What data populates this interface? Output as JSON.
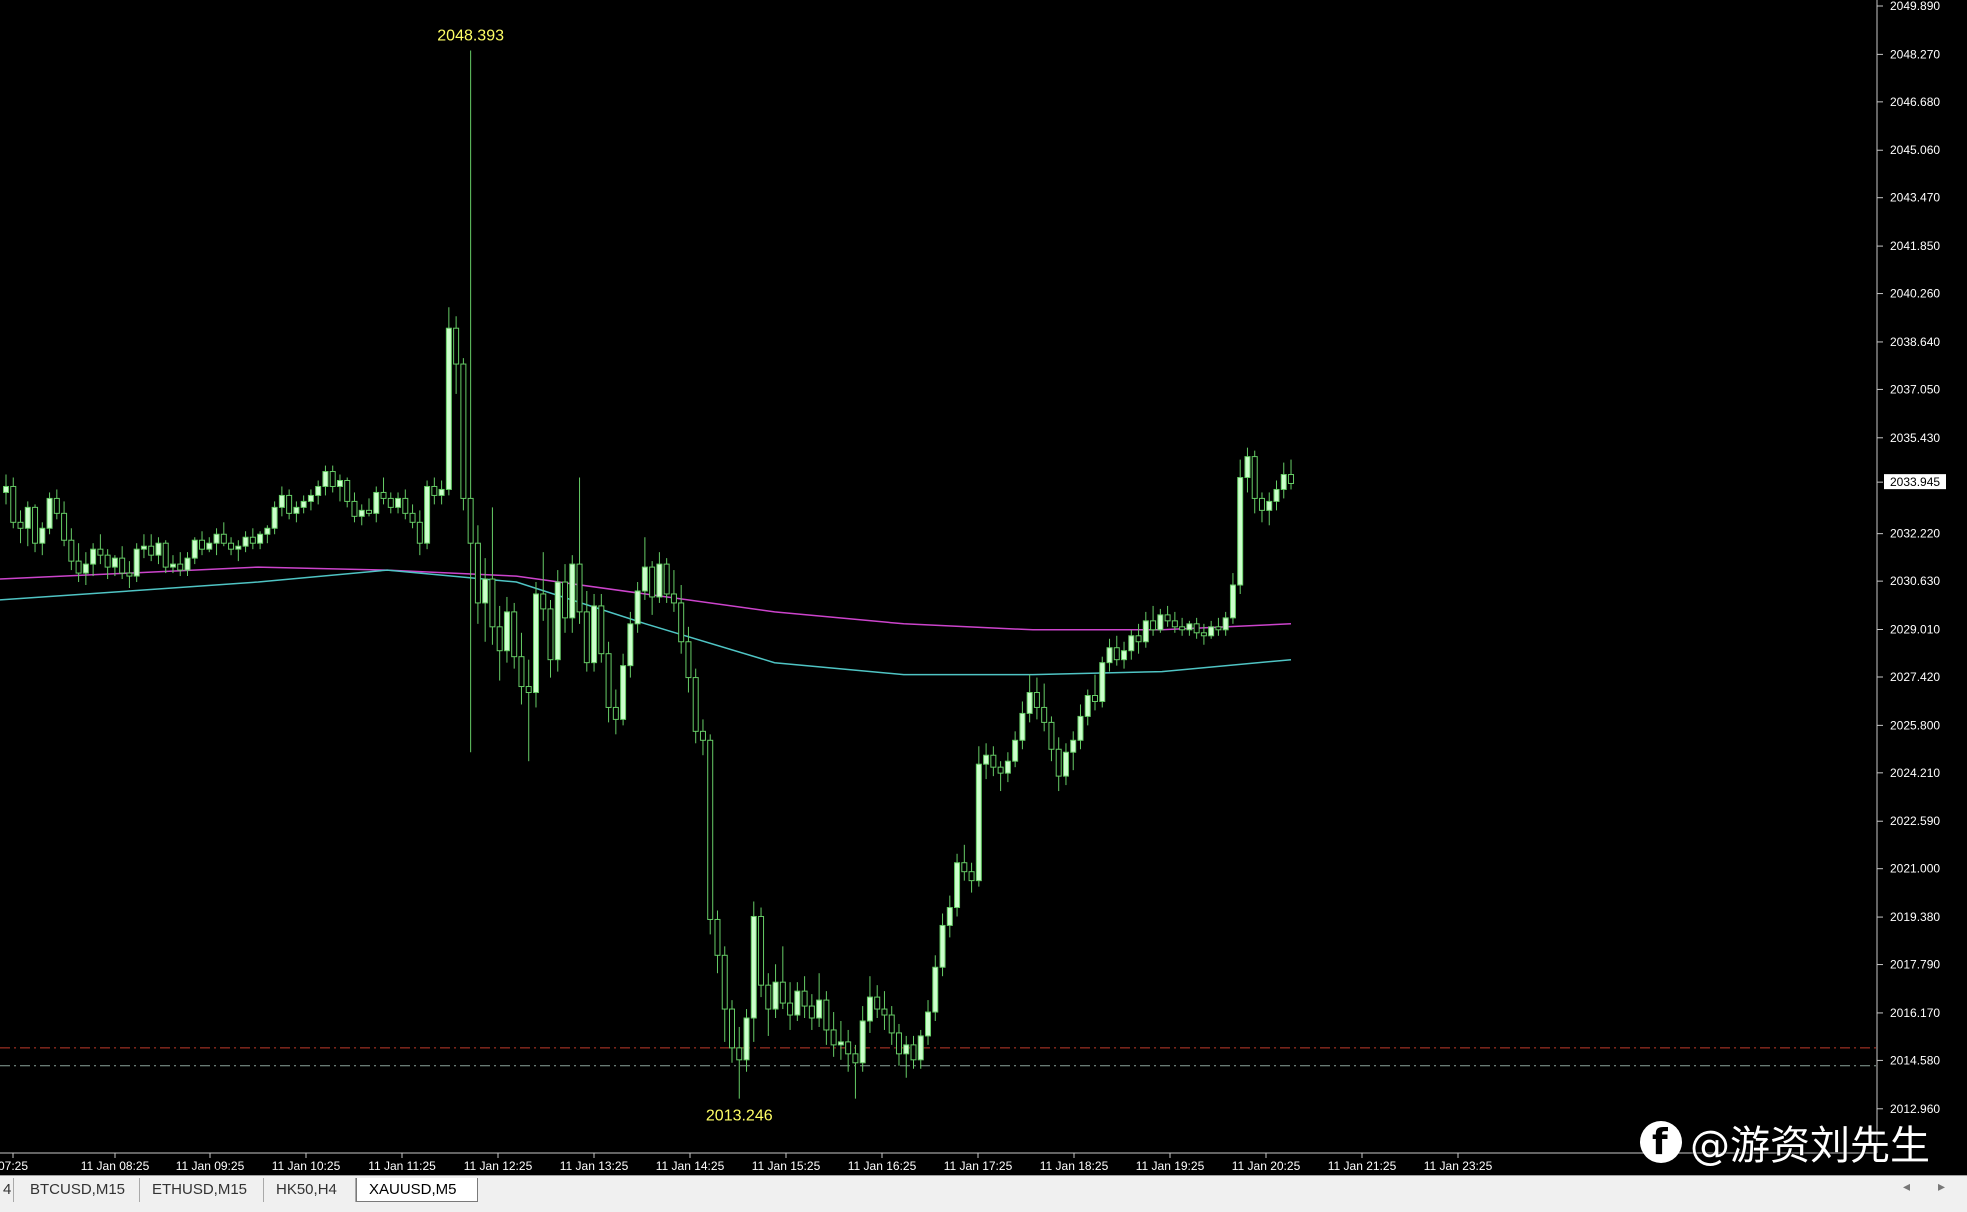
{
  "chart_data": {
    "type": "candlestick",
    "symbol": "XAUUSD,M5",
    "ylim": [
      2012.35,
      2049.89
    ],
    "y_ticks": [
      "2049.890",
      "2048.270",
      "2046.680",
      "2045.060",
      "2043.470",
      "2041.850",
      "2040.260",
      "2038.640",
      "2037.050",
      "2035.430",
      "2033.945",
      "2032.220",
      "2030.630",
      "2029.010",
      "2027.420",
      "2025.800",
      "2024.210",
      "2022.590",
      "2021.000",
      "2019.380",
      "2017.790",
      "2016.170",
      "2014.580",
      "2012.960"
    ],
    "current_price": "2033.945",
    "x_ticks": [
      "07:25",
      "11 Jan 08:25",
      "11 Jan 09:25",
      "11 Jan 10:25",
      "11 Jan 11:25",
      "11 Jan 12:25",
      "11 Jan 13:25",
      "11 Jan 14:25",
      "11 Jan 15:25",
      "11 Jan 16:25",
      "11 Jan 17:25",
      "11 Jan 18:25",
      "11 Jan 19:25",
      "11 Jan 20:25",
      "11 Jan 21:25",
      "11 Jan 23:25"
    ],
    "annotations": {
      "high": "2048.393",
      "low": "2013.246"
    },
    "horizontal_lines": [
      {
        "value": 2015.0,
        "color": "#c0392b",
        "style": "dash-dot"
      },
      {
        "value": 2014.4,
        "color": "#8aa39a",
        "style": "dash-dot"
      }
    ],
    "moving_averages": [
      {
        "color": "#cc44cc",
        "points": [
          2030.7,
          2030.9,
          2031.1,
          2031.0,
          2030.8,
          2030.2,
          2029.6,
          2029.2,
          2029.0,
          2029.0,
          2029.2
        ]
      },
      {
        "color": "#4fc4c4",
        "points": [
          2030.0,
          2030.3,
          2030.6,
          2031.0,
          2030.6,
          2029.2,
          2027.9,
          2027.5,
          2027.5,
          2027.6,
          2028.0
        ]
      }
    ],
    "candles": [
      [
        2033.6,
        2034.2,
        2033.2,
        2033.8
      ],
      [
        2033.8,
        2034.1,
        2032.4,
        2032.6
      ],
      [
        2032.6,
        2033.0,
        2031.9,
        2032.4
      ],
      [
        2032.4,
        2033.3,
        2031.8,
        2033.1
      ],
      [
        2033.1,
        2033.2,
        2031.6,
        2031.9
      ],
      [
        2031.9,
        2032.6,
        2031.5,
        2032.4
      ],
      [
        2032.4,
        2033.6,
        2032.2,
        2033.4
      ],
      [
        2033.4,
        2033.7,
        2032.7,
        2032.9
      ],
      [
        2032.9,
        2033.3,
        2031.8,
        2032.0
      ],
      [
        2032.0,
        2032.4,
        2031.0,
        2031.3
      ],
      [
        2031.3,
        2031.9,
        2030.6,
        2030.9
      ],
      [
        2030.9,
        2031.6,
        2030.5,
        2031.2
      ],
      [
        2031.2,
        2031.9,
        2030.8,
        2031.7
      ],
      [
        2031.7,
        2032.2,
        2031.2,
        2031.5
      ],
      [
        2031.5,
        2031.7,
        2030.7,
        2031.1
      ],
      [
        2031.1,
        2031.5,
        2030.8,
        2031.4
      ],
      [
        2031.4,
        2031.8,
        2030.7,
        2030.9
      ],
      [
        2030.9,
        2031.3,
        2030.4,
        2030.8
      ],
      [
        2030.8,
        2031.9,
        2030.6,
        2031.7
      ],
      [
        2031.7,
        2032.2,
        2031.4,
        2031.8
      ],
      [
        2031.8,
        2032.2,
        2031.3,
        2031.5
      ],
      [
        2031.5,
        2032.1,
        2031.2,
        2031.9
      ],
      [
        2031.9,
        2032.0,
        2030.9,
        2031.1
      ],
      [
        2031.1,
        2031.5,
        2030.9,
        2031.2
      ],
      [
        2031.2,
        2031.6,
        2030.8,
        2031.0
      ],
      [
        2031.0,
        2031.6,
        2030.8,
        2031.4
      ],
      [
        2031.4,
        2032.1,
        2031.2,
        2032.0
      ],
      [
        2032.0,
        2032.3,
        2031.5,
        2031.7
      ],
      [
        2031.7,
        2032.1,
        2031.6,
        2031.9
      ],
      [
        2031.9,
        2032.4,
        2031.5,
        2032.2
      ],
      [
        2032.2,
        2032.6,
        2031.8,
        2031.9
      ],
      [
        2031.9,
        2032.1,
        2031.5,
        2031.7
      ],
      [
        2031.7,
        2032.0,
        2031.3,
        2031.8
      ],
      [
        2031.8,
        2032.3,
        2031.6,
        2032.1
      ],
      [
        2032.1,
        2032.4,
        2031.7,
        2031.9
      ],
      [
        2031.9,
        2032.3,
        2031.7,
        2032.2
      ],
      [
        2032.2,
        2032.5,
        2031.9,
        2032.4
      ],
      [
        2032.4,
        2033.3,
        2032.2,
        2033.1
      ],
      [
        2033.1,
        2033.8,
        2032.8,
        2033.5
      ],
      [
        2033.5,
        2033.7,
        2032.7,
        2032.9
      ],
      [
        2032.9,
        2033.3,
        2032.6,
        2033.1
      ],
      [
        2033.1,
        2033.5,
        2032.9,
        2033.3
      ],
      [
        2033.3,
        2033.7,
        2033.0,
        2033.5
      ],
      [
        2033.5,
        2034.0,
        2033.2,
        2033.8
      ],
      [
        2033.8,
        2034.5,
        2033.5,
        2034.3
      ],
      [
        2034.3,
        2034.5,
        2033.6,
        2033.8
      ],
      [
        2033.8,
        2034.2,
        2033.3,
        2034.0
      ],
      [
        2034.0,
        2034.1,
        2033.1,
        2033.3
      ],
      [
        2033.3,
        2033.6,
        2032.6,
        2032.8
      ],
      [
        2032.8,
        2033.2,
        2032.5,
        2033.0
      ],
      [
        2033.0,
        2033.4,
        2032.8,
        2032.9
      ],
      [
        2032.9,
        2033.8,
        2032.6,
        2033.6
      ],
      [
        2033.6,
        2034.1,
        2033.2,
        2033.4
      ],
      [
        2033.4,
        2033.6,
        2032.9,
        2033.1
      ],
      [
        2033.1,
        2033.6,
        2032.9,
        2033.4
      ],
      [
        2033.4,
        2033.7,
        2032.7,
        2032.9
      ],
      [
        2032.9,
        2033.2,
        2032.4,
        2032.6
      ],
      [
        2032.6,
        2033.0,
        2031.5,
        2031.9
      ],
      [
        2031.9,
        2034.0,
        2031.7,
        2033.8
      ],
      [
        2033.8,
        2034.1,
        2033.2,
        2033.5
      ],
      [
        2033.5,
        2034.0,
        2033.2,
        2033.7
      ],
      [
        2033.7,
        2039.8,
        2033.5,
        2039.1
      ],
      [
        2039.1,
        2039.5,
        2036.9,
        2037.9
      ],
      [
        2037.9,
        2038.1,
        2033.0,
        2033.4
      ],
      [
        2033.4,
        2048.4,
        2024.9,
        2031.9
      ],
      [
        2031.9,
        2032.5,
        2029.2,
        2029.9
      ],
      [
        2029.9,
        2031.4,
        2028.6,
        2030.7
      ],
      [
        2030.7,
        2033.1,
        2028.5,
        2029.1
      ],
      [
        2029.1,
        2029.8,
        2027.3,
        2028.3
      ],
      [
        2028.3,
        2030.1,
        2027.9,
        2029.6
      ],
      [
        2029.6,
        2029.9,
        2027.7,
        2028.1
      ],
      [
        2028.1,
        2028.9,
        2026.5,
        2027.1
      ],
      [
        2027.1,
        2028.0,
        2024.6,
        2026.9
      ],
      [
        2026.9,
        2030.6,
        2026.4,
        2030.2
      ],
      [
        2030.2,
        2031.6,
        2029.3,
        2029.7
      ],
      [
        2029.7,
        2030.0,
        2027.4,
        2028.0
      ],
      [
        2028.0,
        2031.0,
        2027.6,
        2030.6
      ],
      [
        2030.6,
        2031.2,
        2028.9,
        2029.4
      ],
      [
        2029.4,
        2031.5,
        2028.9,
        2031.2
      ],
      [
        2031.2,
        2034.1,
        2029.2,
        2029.6
      ],
      [
        2029.6,
        2030.3,
        2027.6,
        2027.9
      ],
      [
        2027.9,
        2030.2,
        2027.6,
        2029.8
      ],
      [
        2029.8,
        2030.2,
        2027.9,
        2028.2
      ],
      [
        2028.2,
        2028.6,
        2025.9,
        2026.4
      ],
      [
        2026.4,
        2027.0,
        2025.5,
        2026.0
      ],
      [
        2026.0,
        2028.2,
        2025.8,
        2027.8
      ],
      [
        2027.8,
        2029.6,
        2027.4,
        2029.2
      ],
      [
        2029.2,
        2030.6,
        2028.9,
        2030.3
      ],
      [
        2030.3,
        2032.1,
        2030.0,
        2031.1
      ],
      [
        2031.1,
        2031.3,
        2029.5,
        2030.1
      ],
      [
        2030.1,
        2031.6,
        2029.9,
        2031.2
      ],
      [
        2031.2,
        2031.4,
        2029.9,
        2030.2
      ],
      [
        2030.2,
        2031.0,
        2029.6,
        2029.9
      ],
      [
        2029.9,
        2030.5,
        2028.2,
        2028.6
      ],
      [
        2028.6,
        2029.1,
        2026.9,
        2027.4
      ],
      [
        2027.4,
        2027.7,
        2025.2,
        2025.6
      ],
      [
        2025.6,
        2026.0,
        2024.8,
        2025.3
      ],
      [
        2025.3,
        2025.5,
        2018.8,
        2019.3
      ],
      [
        2019.3,
        2019.6,
        2017.5,
        2018.1
      ],
      [
        2018.1,
        2018.4,
        2015.2,
        2016.3
      ],
      [
        2016.3,
        2016.6,
        2014.5,
        2015.0
      ],
      [
        2015.0,
        2015.7,
        2013.3,
        2014.6
      ],
      [
        2014.6,
        2016.3,
        2014.2,
        2016.0
      ],
      [
        2016.0,
        2019.9,
        2015.2,
        2019.4
      ],
      [
        2019.4,
        2019.7,
        2016.7,
        2017.1
      ],
      [
        2017.1,
        2017.5,
        2015.4,
        2016.3
      ],
      [
        2016.3,
        2017.8,
        2016.0,
        2017.2
      ],
      [
        2017.2,
        2018.4,
        2016.3,
        2016.5
      ],
      [
        2016.5,
        2017.2,
        2015.6,
        2016.1
      ],
      [
        2016.1,
        2017.2,
        2015.9,
        2016.9
      ],
      [
        2016.9,
        2017.4,
        2016.0,
        2016.4
      ],
      [
        2016.4,
        2016.8,
        2015.6,
        2016.0
      ],
      [
        2016.0,
        2017.5,
        2015.7,
        2016.6
      ],
      [
        2016.6,
        2016.9,
        2015.1,
        2015.6
      ],
      [
        2015.6,
        2016.2,
        2014.7,
        2015.1
      ],
      [
        2015.1,
        2015.9,
        2014.6,
        2015.2
      ],
      [
        2015.2,
        2015.6,
        2014.2,
        2014.8
      ],
      [
        2014.8,
        2015.1,
        2013.3,
        2014.5
      ],
      [
        2014.5,
        2016.4,
        2014.2,
        2015.9
      ],
      [
        2015.9,
        2017.4,
        2015.5,
        2016.7
      ],
      [
        2016.7,
        2017.1,
        2016.0,
        2016.3
      ],
      [
        2016.3,
        2016.9,
        2015.6,
        2016.1
      ],
      [
        2016.1,
        2016.4,
        2015.1,
        2015.5
      ],
      [
        2015.5,
        2015.8,
        2014.4,
        2014.8
      ],
      [
        2014.8,
        2015.4,
        2014.0,
        2015.1
      ],
      [
        2015.1,
        2015.4,
        2014.3,
        2014.6
      ],
      [
        2014.6,
        2015.6,
        2014.3,
        2015.4
      ],
      [
        2015.4,
        2016.6,
        2015.1,
        2016.2
      ],
      [
        2016.2,
        2018.1,
        2015.9,
        2017.7
      ],
      [
        2017.7,
        2019.5,
        2017.4,
        2019.1
      ],
      [
        2019.1,
        2020.1,
        2018.7,
        2019.7
      ],
      [
        2019.7,
        2021.5,
        2019.4,
        2021.2
      ],
      [
        2021.2,
        2021.8,
        2020.6,
        2020.9
      ],
      [
        2020.9,
        2021.2,
        2020.2,
        2020.6
      ],
      [
        2020.6,
        2025.1,
        2020.4,
        2024.5
      ],
      [
        2024.5,
        2025.2,
        2024.0,
        2024.8
      ],
      [
        2024.8,
        2025.1,
        2024.1,
        2024.4
      ],
      [
        2024.4,
        2024.6,
        2023.6,
        2024.2
      ],
      [
        2024.2,
        2024.9,
        2023.9,
        2024.6
      ],
      [
        2024.6,
        2025.6,
        2024.4,
        2025.3
      ],
      [
        2025.3,
        2026.6,
        2025.0,
        2026.2
      ],
      [
        2026.2,
        2027.5,
        2025.9,
        2026.9
      ],
      [
        2026.9,
        2027.4,
        2026.0,
        2026.4
      ],
      [
        2026.4,
        2027.2,
        2025.6,
        2025.9
      ],
      [
        2025.9,
        2026.1,
        2024.6,
        2025.0
      ],
      [
        2025.0,
        2025.4,
        2023.6,
        2024.1
      ],
      [
        2024.1,
        2025.2,
        2023.8,
        2024.9
      ],
      [
        2024.9,
        2025.6,
        2024.3,
        2025.3
      ],
      [
        2025.3,
        2026.5,
        2025.0,
        2026.1
      ],
      [
        2026.1,
        2027.0,
        2025.8,
        2026.8
      ],
      [
        2026.8,
        2027.5,
        2026.3,
        2026.6
      ],
      [
        2026.6,
        2028.1,
        2026.4,
        2027.9
      ],
      [
        2027.9,
        2028.7,
        2027.6,
        2028.4
      ],
      [
        2028.4,
        2028.8,
        2027.8,
        2028.0
      ],
      [
        2028.0,
        2028.6,
        2027.7,
        2028.3
      ],
      [
        2028.3,
        2029.0,
        2028.0,
        2028.8
      ],
      [
        2028.8,
        2029.2,
        2028.2,
        2028.6
      ],
      [
        2028.6,
        2029.6,
        2028.4,
        2029.3
      ],
      [
        2029.3,
        2029.8,
        2028.8,
        2029.0
      ],
      [
        2029.0,
        2029.7,
        2028.9,
        2029.5
      ],
      [
        2029.5,
        2029.8,
        2029.1,
        2029.3
      ],
      [
        2029.3,
        2029.6,
        2028.9,
        2029.1
      ],
      [
        2029.1,
        2029.4,
        2028.8,
        2029.0
      ],
      [
        2029.0,
        2029.3,
        2028.8,
        2029.2
      ],
      [
        2029.2,
        2029.4,
        2028.7,
        2028.9
      ],
      [
        2028.9,
        2029.2,
        2028.5,
        2028.8
      ],
      [
        2028.8,
        2029.3,
        2028.7,
        2029.1
      ],
      [
        2029.1,
        2029.4,
        2028.8,
        2029.0
      ],
      [
        2029.0,
        2029.6,
        2028.8,
        2029.4
      ],
      [
        2029.4,
        2030.9,
        2029.2,
        2030.5
      ],
      [
        2030.5,
        2034.7,
        2030.2,
        2034.1
      ],
      [
        2034.1,
        2035.1,
        2033.6,
        2034.8
      ],
      [
        2034.8,
        2035.0,
        2032.9,
        2033.4
      ],
      [
        2033.4,
        2033.6,
        2032.6,
        2033.0
      ],
      [
        2033.0,
        2033.6,
        2032.5,
        2033.3
      ],
      [
        2033.3,
        2034.0,
        2033.0,
        2033.7
      ],
      [
        2033.7,
        2034.6,
        2033.4,
        2034.2
      ],
      [
        2034.2,
        2034.7,
        2033.7,
        2033.9
      ]
    ]
  },
  "tabs": [
    {
      "label": "4"
    },
    {
      "label": "BTCUSD,M15"
    },
    {
      "label": "ETHUSD,M15"
    },
    {
      "label": "HK50,H4"
    },
    {
      "label": "XAUUSD,M5"
    }
  ],
  "tab_arrows": "◂ ▸",
  "watermark": {
    "text": "@游资刘先生",
    "logo_icon": "facebook-logo-icon"
  },
  "colors": {
    "background": "#000000",
    "candle_up": "#ccffcc",
    "candle_down": "#000000",
    "wick": "#66cc66",
    "axis_text": "#ffffff",
    "annotation_text": "#ffff66"
  }
}
